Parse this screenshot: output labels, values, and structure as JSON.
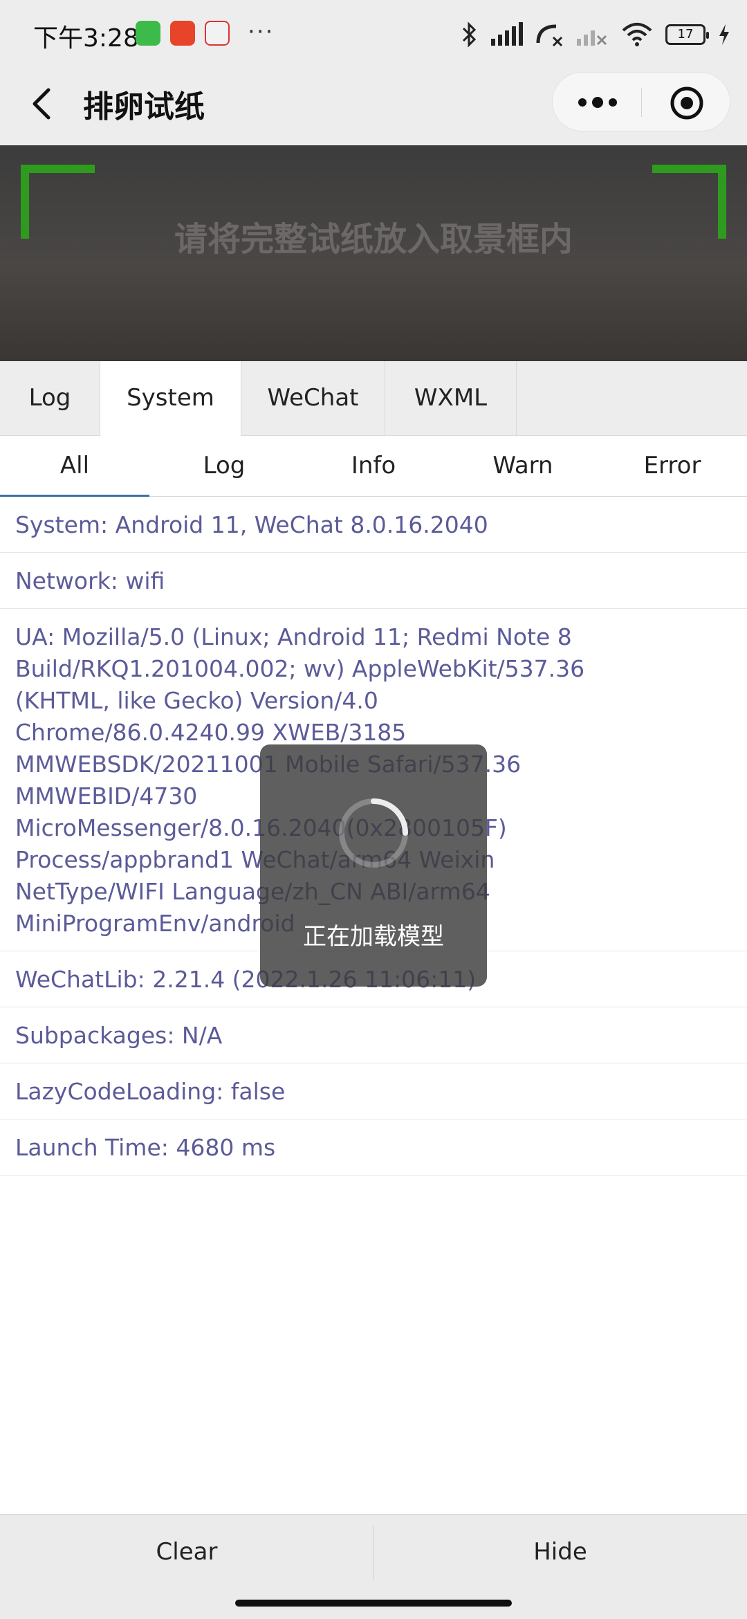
{
  "status_bar": {
    "time": "下午3:28",
    "battery": "17",
    "more": "···"
  },
  "nav": {
    "title": "排卵试纸"
  },
  "camera": {
    "hint": "请将完整试纸放入取景框内"
  },
  "console_tabs": [
    "Log",
    "System",
    "WeChat",
    "WXML"
  ],
  "filter_tabs": [
    "All",
    "Log",
    "Info",
    "Warn",
    "Error"
  ],
  "system_log": {
    "system": "System: Android 11, WeChat 8.0.16.2040",
    "network": "Network: wifi",
    "ua_lines": [
      "UA: Mozilla/5.0 (Linux; Android 11; Redmi Note 8",
      "Build/RKQ1.201004.002; wv) AppleWebKit/537.36",
      "(KHTML, like Gecko) Version/4.0",
      "Chrome/86.0.4240.99 XWEB/3185",
      "MMWEBSDK/20211001 Mobile Safari/537.36",
      "MMWEBID/4730",
      "MicroMessenger/8.0.16.2040(0x2800105F)",
      "Process/appbrand1 WeChat/arm64 Weixin",
      "NetType/WIFI Language/zh_CN ABI/arm64",
      "MiniProgramEnv/android"
    ],
    "wechatlib": "WeChatLib: 2.21.4 (2022.1.26 11:06:11)",
    "subpackages": "Subpackages: N/A",
    "lazy": "LazyCodeLoading: false",
    "launch": "Launch Time: 4680 ms"
  },
  "toast": {
    "text": "正在加载模型"
  },
  "bottom": {
    "clear": "Clear",
    "hide": "Hide"
  },
  "colors": {
    "log_text": "#5b5b99",
    "viewfinder": "#2f9b1e",
    "active_tab_underline": "#3f6ea8"
  }
}
